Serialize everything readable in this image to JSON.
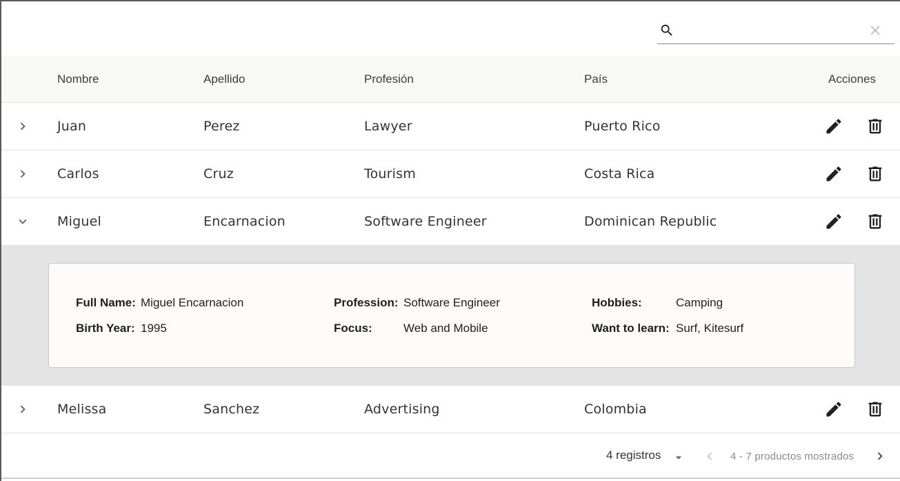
{
  "search": {
    "value": "",
    "placeholder": ""
  },
  "table": {
    "headers": {
      "name": "Nombre",
      "lastname": "Apellido",
      "profession": "Profesión",
      "country": "País",
      "actions": "Acciones"
    },
    "rows": [
      {
        "name": "Juan",
        "lastname": "Perez",
        "profession": "Lawyer",
        "country": "Puerto Rico",
        "expanded": false
      },
      {
        "name": "Carlos",
        "lastname": "Cruz",
        "profession": "Tourism",
        "country": "Costa Rica",
        "expanded": false
      },
      {
        "name": "Miguel",
        "lastname": "Encarnacion",
        "profession": "Software Engineer",
        "country": "Dominican Republic",
        "expanded": true
      },
      {
        "name": "Melissa",
        "lastname": "Sanchez",
        "profession": "Advertising",
        "country": "Colombia",
        "expanded": false
      }
    ]
  },
  "detail": {
    "full_name_label": "Full Name:",
    "full_name": "Miguel Encarnacion",
    "birth_year_label": "Birth Year:",
    "birth_year": "1995",
    "profession_label": "Profession:",
    "profession": "Software Engineer",
    "focus_label": "Focus:",
    "focus": "Web and Mobile",
    "hobbies_label": "Hobbies:",
    "hobbies": "Camping",
    "learn_label": "Want to learn:",
    "learn": "Surf, Kitesurf"
  },
  "pagination": {
    "page_size_label": "4 registros",
    "range_label": "4 - 7 productos mostrados"
  },
  "colors": {
    "icon": "#212121",
    "icon_muted": "#bdbdbd",
    "header_bg": "#f8f8f6",
    "detail_bg": "#e4e4e4"
  }
}
